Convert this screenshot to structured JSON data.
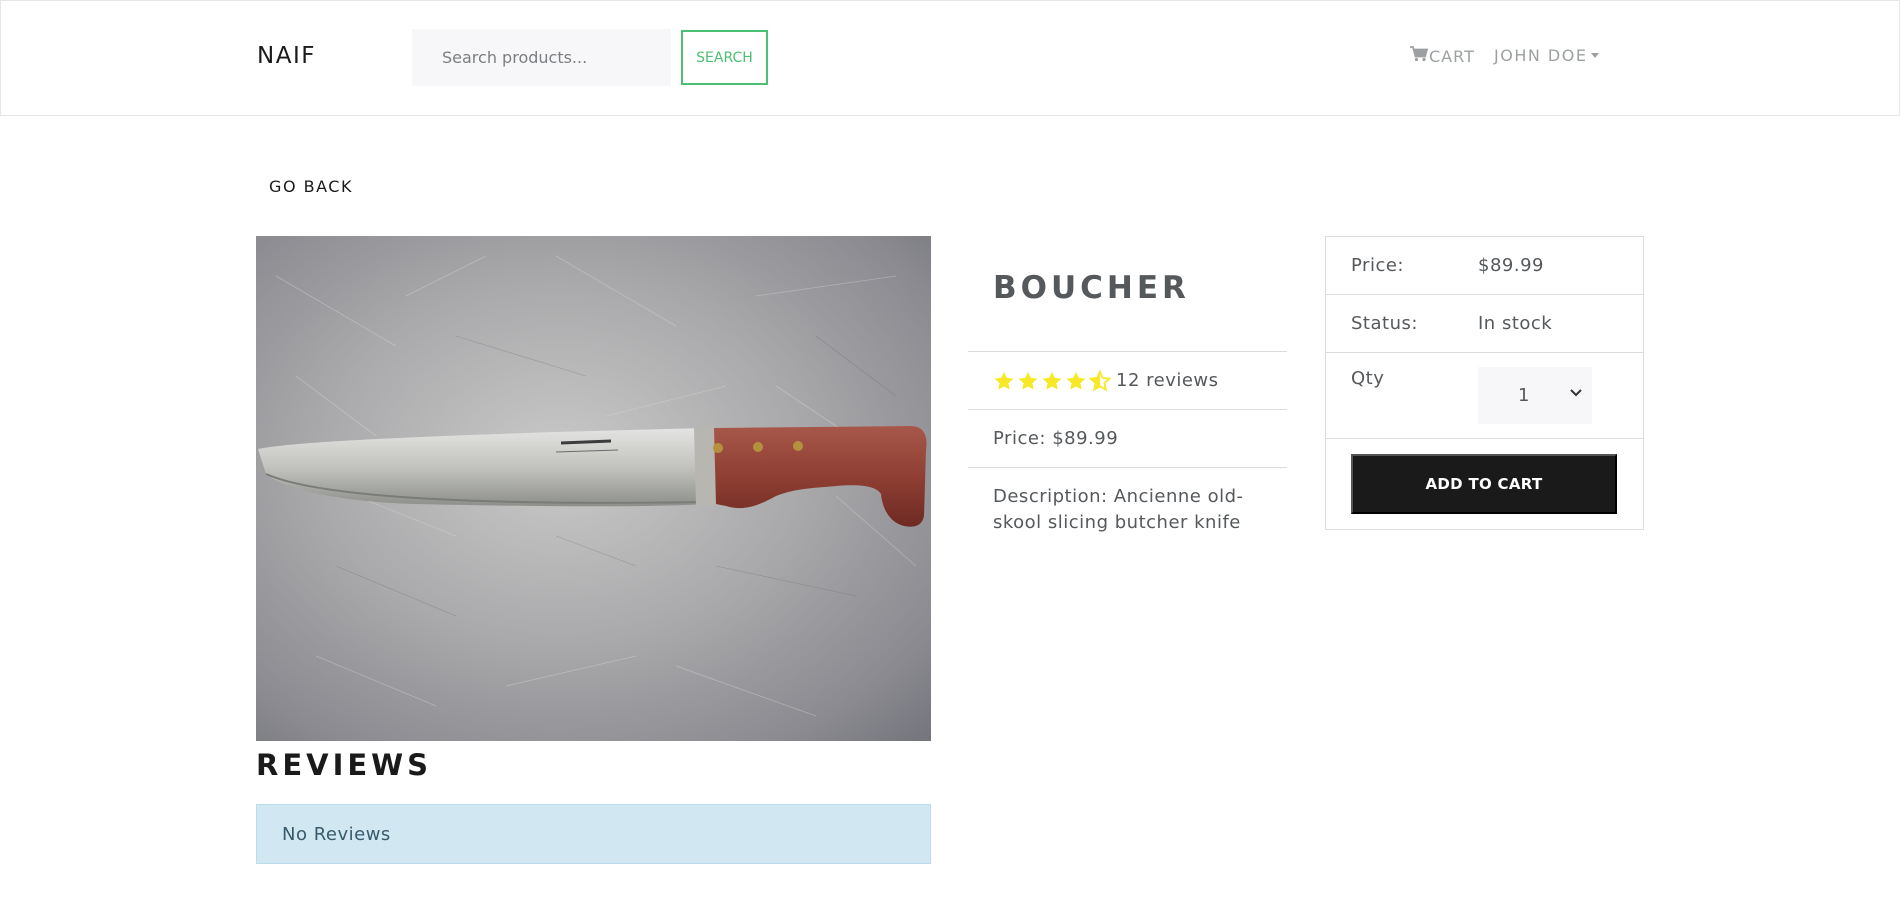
{
  "header": {
    "brand": "NAIF",
    "search_placeholder": "Search products...",
    "search_button": "SEARCH",
    "cart_label": "CART",
    "user_name": "JOHN DOE"
  },
  "go_back": "GO BACK",
  "product": {
    "name": "BOUCHER",
    "rating": 4.5,
    "reviews_text": "12 reviews",
    "price_text": "Price: $89.99",
    "description_text": "Description: Ancienne old-skool slicing butcher knife",
    "image_icon": "knife-photo"
  },
  "buy_card": {
    "price_label": "Price:",
    "price_value": "$89.99",
    "status_label": "Status:",
    "status_value": "In stock",
    "qty_label": "Qty",
    "qty_value": "1",
    "add_to_cart": "ADD TO CART"
  },
  "reviews": {
    "heading": "REVIEWS",
    "empty_message": "No Reviews"
  },
  "colors": {
    "accent_green": "#4bbf73",
    "star_yellow": "#f8e825",
    "dark": "#1a1a1a",
    "info_bg": "#d1e8f2"
  }
}
